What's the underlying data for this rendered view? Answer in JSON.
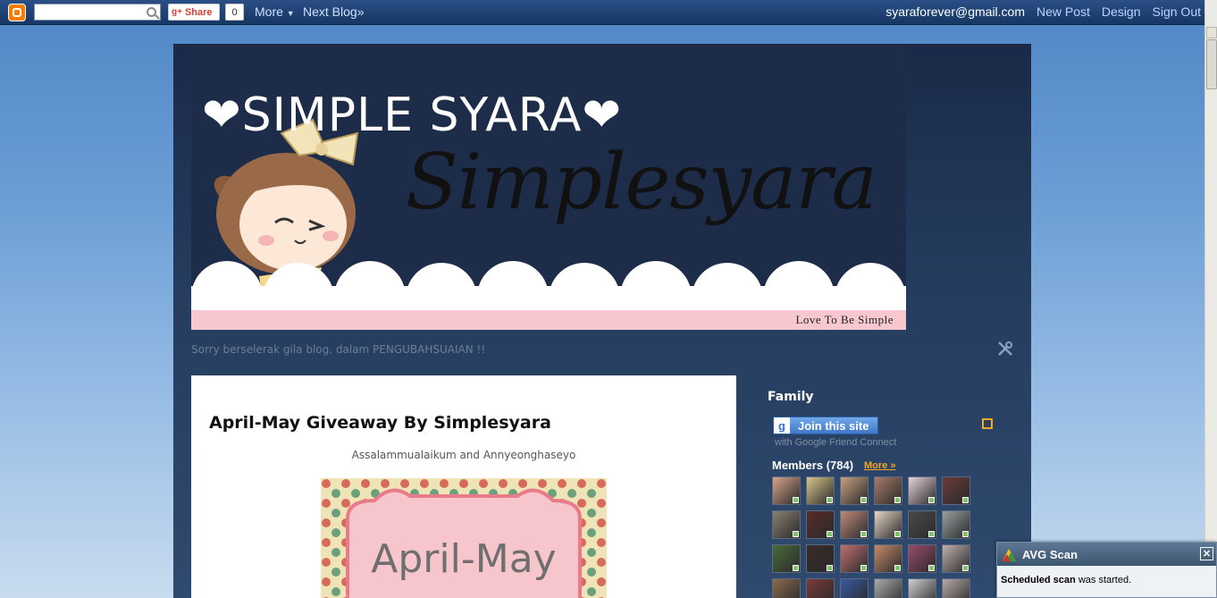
{
  "navbar": {
    "search_value": "",
    "share_label": "Share",
    "share_count": "0",
    "more_label": "More",
    "next_blog_label": "Next Blog»",
    "email": "syaraforever@gmail.com",
    "new_post_label": "New Post",
    "design_label": "Design",
    "sign_out_label": "Sign Out"
  },
  "blog": {
    "header_title": "❤SIMPLE SYARA❤",
    "script_title": "Simplesyara",
    "tagline": "Love To Be Simple",
    "description": "Sorry berselerak gila blog. dalam PENGUBAHSUAIAN !!"
  },
  "post": {
    "title": "April-May Giveaway By Simplesyara",
    "greeting": "Assalammualaikum and Annyeonghaseyo",
    "image_text": "April-May"
  },
  "sidebar": {
    "family_title": "Family",
    "join_label": "Join this site",
    "gfc_sub": "with Google Friend Connect",
    "members_label": "Members (784)",
    "more_label": "More »"
  },
  "avg": {
    "title": "AVG Scan",
    "message_bold": "Scheduled scan",
    "message_rest": " was started."
  },
  "colors": {
    "nav_bg": "#1f4272",
    "post_bg": "#ffffff",
    "accent_orange": "#f5a623",
    "pink_strip": "#f8c8d0"
  },
  "avatar_colors": [
    "#d9a48a",
    "#d8c58a",
    "#c7a080",
    "#a87a6a",
    "#e7d2dc",
    "#6a3a3a",
    "#8a8070",
    "#5a2a2a",
    "#c08a7a",
    "#e8d6c6",
    "#4a4a4a",
    "#9aa0a0",
    "#4a6a3a",
    "#3a2a2a",
    "#c07070",
    "#c88a6a",
    "#9a4a6a",
    "#c0b0b0",
    "#8a6a4a",
    "#7a3a3a",
    "#3a5aa0",
    "#aaaaaa",
    "#d0d0d0",
    "#b8a8a8"
  ]
}
